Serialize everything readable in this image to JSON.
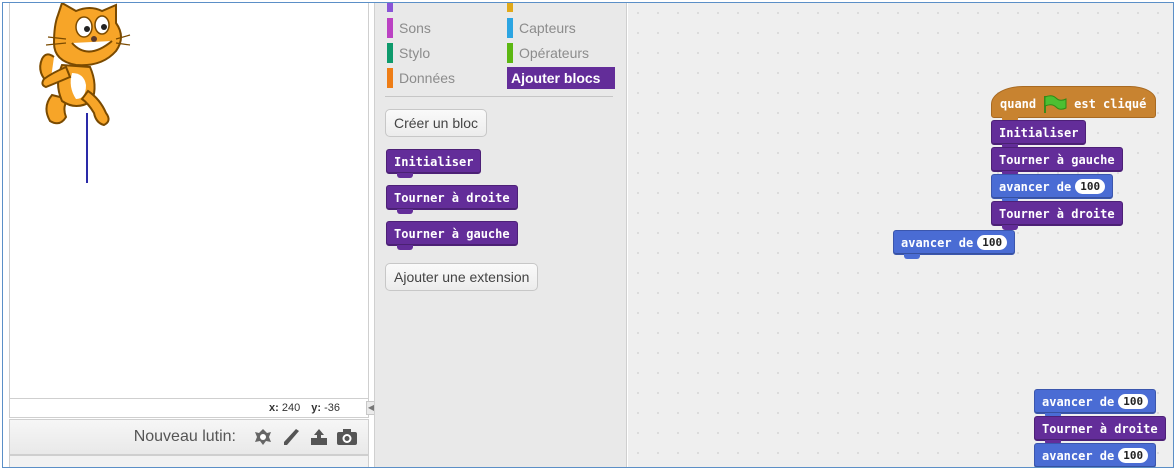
{
  "stage": {
    "sprite_name": "cat",
    "coords": {
      "x_label": "x:",
      "x_value": "240",
      "y_label": "y:",
      "y_value": "-36"
    },
    "new_sprite_label": "Nouveau lutin:",
    "new_sprite_icons": [
      "choose-sprite-icon",
      "paint-sprite-icon",
      "upload-sprite-icon",
      "camera-icon"
    ]
  },
  "palette": {
    "categories": [
      {
        "label": "Sons",
        "color": "#bb42c3"
      },
      {
        "label": "Stylo",
        "color": "#0e9a6c"
      },
      {
        "label": "Données",
        "color": "#ee7d16"
      },
      {
        "label": "Capteurs",
        "color": "#2ca5e2"
      },
      {
        "label": "Opérateurs",
        "color": "#5cb712"
      },
      {
        "label": "Ajouter blocs",
        "color": "#632d99"
      }
    ],
    "create_block": "Créer un bloc",
    "blocks": [
      "Initialiser",
      "Tourner à droite",
      "Tourner à gauche"
    ],
    "add_extension": "Ajouter une extension"
  },
  "scripts": {
    "hat": {
      "prefix": "quand",
      "suffix": "est cliqué",
      "icon": "green-flag-icon"
    },
    "main_stack": [
      {
        "type": "custom",
        "label": "Initialiser"
      },
      {
        "type": "custom",
        "label": "Tourner à gauche"
      },
      {
        "type": "motion",
        "label": "avancer de",
        "value": "100"
      },
      {
        "type": "custom",
        "label": "Tourner à droite"
      }
    ],
    "loose_block": {
      "type": "motion",
      "label": "avancer de",
      "value": "100"
    },
    "bottom_stack": [
      {
        "type": "motion",
        "label": "avancer de",
        "value": "100"
      },
      {
        "type": "custom",
        "label": "Tourner à droite"
      },
      {
        "type": "motion",
        "label": "avancer de",
        "value": "100"
      }
    ]
  },
  "colors": {
    "custom_blocks": "#632d99",
    "motion_blocks": "#4a6cd4",
    "event_blocks": "#c88330",
    "pen_line": "#2a2aa8"
  }
}
